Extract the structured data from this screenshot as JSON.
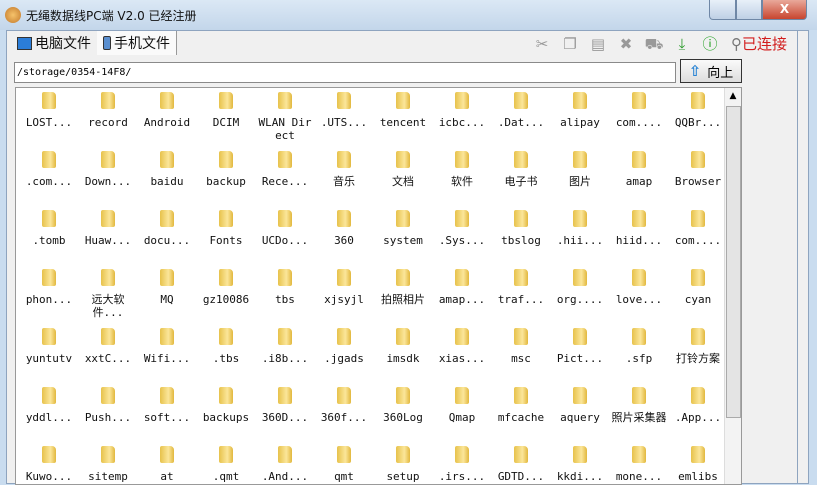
{
  "window": {
    "title": "无绳数据线PC端 V2.0 已经注册",
    "close": "X"
  },
  "tabs": [
    {
      "label": "电脑文件"
    },
    {
      "label": "手机文件"
    }
  ],
  "toolbar": {
    "icons": [
      "cut-icon",
      "copy-icon",
      "paste-icon",
      "delete-icon",
      "cart-icon",
      "download-icon",
      "info-icon"
    ],
    "glyphs": [
      "✂",
      "❐",
      "▤",
      "✖",
      "⛟",
      "⤓",
      "ⓘ"
    ],
    "status": "已连接"
  },
  "path": "/storage/0354-14F8/",
  "up_label": "向上",
  "files": [
    "LOST...",
    "record",
    "Android",
    "DCIM",
    "WLAN Direct",
    ".UTS...",
    "tencent",
    "icbc...",
    ".Dat...",
    "alipay",
    "com....",
    "QQBr...",
    ".com...",
    "Down...",
    "baidu",
    "backup",
    "Rece...",
    "音乐",
    "文档",
    "软件",
    "电子书",
    "图片",
    "amap",
    "Browser",
    ".tomb",
    "Huaw...",
    "docu...",
    "Fonts",
    "UCDo...",
    "360",
    "system",
    ".Sys...",
    "tbslog",
    ".hii...",
    "hiid...",
    "com....",
    "phon...",
    "远大软件...",
    "MQ",
    "gz10086",
    "tbs",
    "xjsyjl",
    "拍照相片",
    "amap...",
    "traf...",
    "org....",
    "love...",
    "cyan",
    "yuntutv",
    "xxtC...",
    "Wifi...",
    ".tbs",
    ".i8b...",
    ".jgads",
    "imsdk",
    "xias...",
    "msc",
    "Pict...",
    ".sfp",
    "打铃方案",
    "yddl...",
    "Push...",
    "soft...",
    "backups",
    "360D...",
    "360f...",
    "360Log",
    "Qmap",
    "mfcache",
    "aquery",
    "照片采集器",
    ".App...",
    "Kuwo...",
    "sitemp",
    "at",
    ".qmt",
    ".And...",
    "qmt",
    "setup",
    ".irs...",
    "GDTD...",
    "kkdi...",
    "mone...",
    "emlibs"
  ]
}
